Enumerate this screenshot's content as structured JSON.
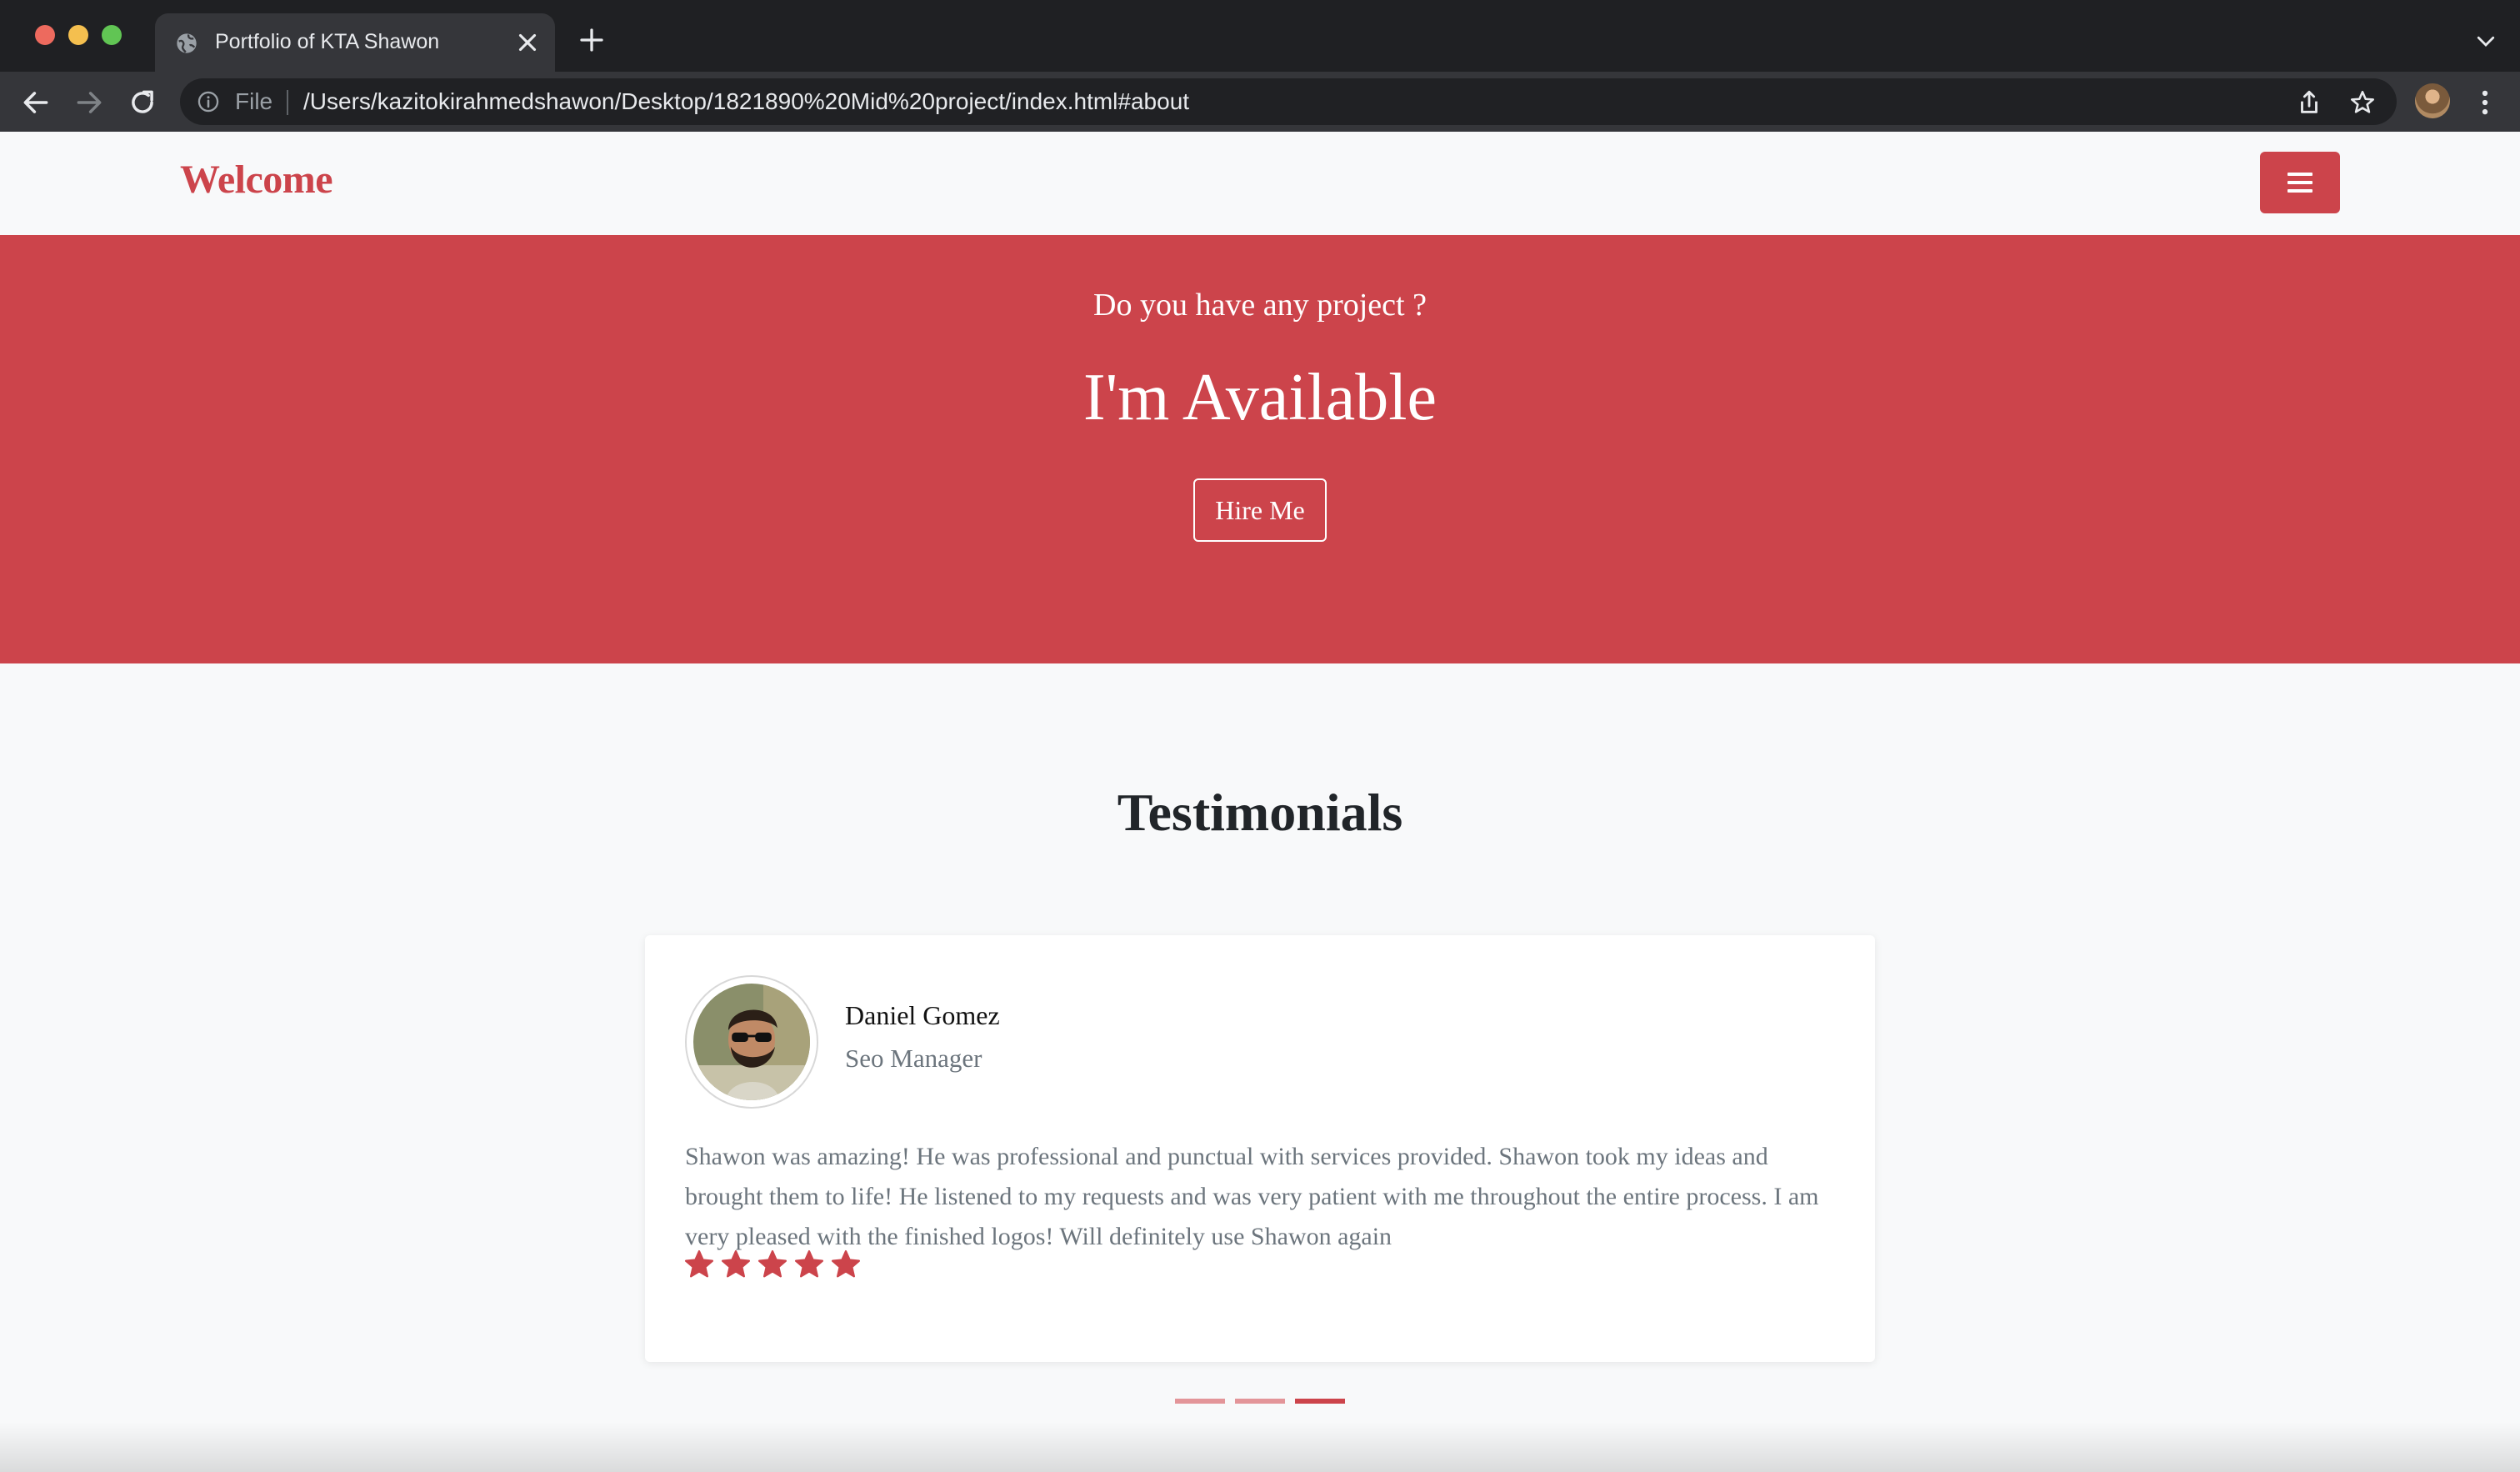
{
  "browser": {
    "tab_title": "Portfolio of KTA Shawon",
    "scheme_label": "File",
    "url": "/Users/kazitokirahmedshawon/Desktop/1821890%20Mid%20project/index.html#about"
  },
  "navbar": {
    "brand": "Welcome",
    "menu_icon": "hamburger-icon"
  },
  "hero": {
    "subtitle": "Do you have any project ?",
    "title": "I'm Available",
    "button_label": "Hire Me"
  },
  "testimonials": {
    "heading": "Testimonials",
    "active_slide": 3,
    "slide_count": 3,
    "current": {
      "name": "Daniel Gomez",
      "role": "Seo Manager",
      "quote": "Shawon was amazing! He was professional and punctual with services provided. Shawon took my ideas and brought them to life! He listened to my requests and was very patient with me throughout the entire process. I am very pleased with the finished logos! Will definitely use Shawon again",
      "rating": 5,
      "rating_max": 5
    }
  },
  "colors": {
    "accent": "#cc444b",
    "indicator_inactive": "#e39599",
    "page_bg": "#f8f9fa",
    "chrome_dark": "#1f2023",
    "chrome_toolbar": "#35363a"
  }
}
